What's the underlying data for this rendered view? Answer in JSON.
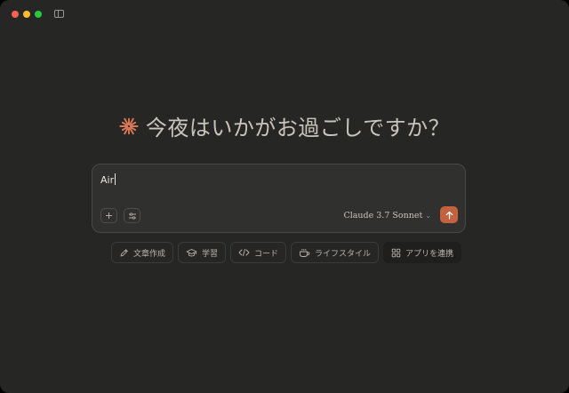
{
  "window": {
    "controls": [
      "close",
      "minimize",
      "maximize"
    ],
    "sidebar_toggle_icon": "sidebar-icon"
  },
  "greeting": {
    "icon": "claude-asterisk-logo",
    "icon_color": "#d97757",
    "text": "今夜はいかがお過ごしですか？"
  },
  "composer": {
    "input_value": "Air",
    "add_icon": "plus-icon",
    "tools_icon": "sliders-icon",
    "model_label": "Claude 3.7 Sonnet",
    "model_chevron": "⌄",
    "send_icon": "arrow-up-icon",
    "send_color": "#c4613f"
  },
  "chips": [
    {
      "icon": "pencil-icon",
      "label": "文章作成"
    },
    {
      "icon": "graduation-cap-icon",
      "label": "学習"
    },
    {
      "icon": "code-icon",
      "label": "コード"
    },
    {
      "icon": "coffee-cup-icon",
      "label": "ライフスタイル"
    },
    {
      "icon": "apps-grid-icon",
      "label": "アプリを連携"
    }
  ]
}
